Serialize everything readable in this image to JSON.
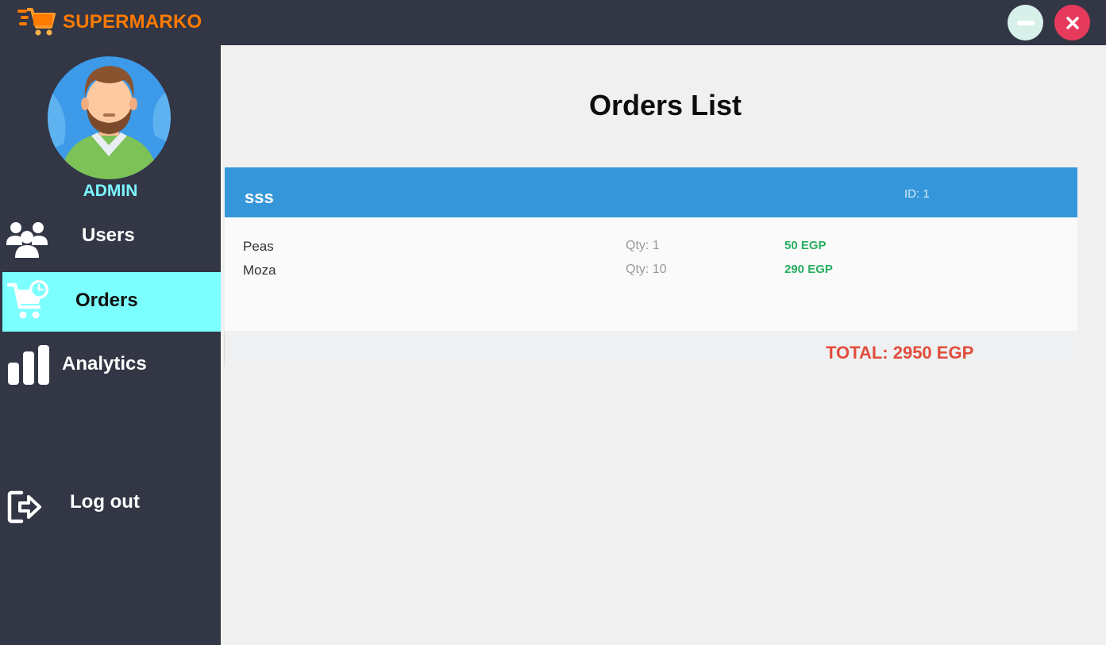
{
  "app": {
    "title": "SUPERMARKO",
    "logo_icon": "shopping-cart-speed-icon"
  },
  "window_controls": {
    "minimize_icon": "minimize-icon",
    "close_icon": "close-icon"
  },
  "sidebar": {
    "user_role": "ADMIN",
    "avatar_icon": "user-avatar",
    "items": [
      {
        "label": "Users",
        "icon": "users-group-icon",
        "active": false
      },
      {
        "label": "Orders",
        "icon": "cart-clock-icon",
        "active": true
      },
      {
        "label": "Analytics",
        "icon": "bar-chart-icon",
        "active": false
      }
    ],
    "logout": {
      "label": "Log out",
      "icon": "logout-icon"
    }
  },
  "main": {
    "title": "Orders List",
    "orders": [
      {
        "name": "sss",
        "id_text": "ID: 1",
        "items": [
          {
            "name": "Peas",
            "qty": "Qty: 1",
            "price": "50 EGP"
          },
          {
            "name": "Moza",
            "qty": "Qty: 10",
            "price": "290 EGP"
          }
        ],
        "total": "TOTAL: 2950 EGP"
      }
    ]
  },
  "colors": {
    "app_bar": "#323645",
    "brand": "#ff7a00",
    "active_nav": "#7bffff",
    "order_header": "#3597d9",
    "price": "#27ae60",
    "total": "#e24c3c",
    "close_button": "#e63a5c"
  }
}
